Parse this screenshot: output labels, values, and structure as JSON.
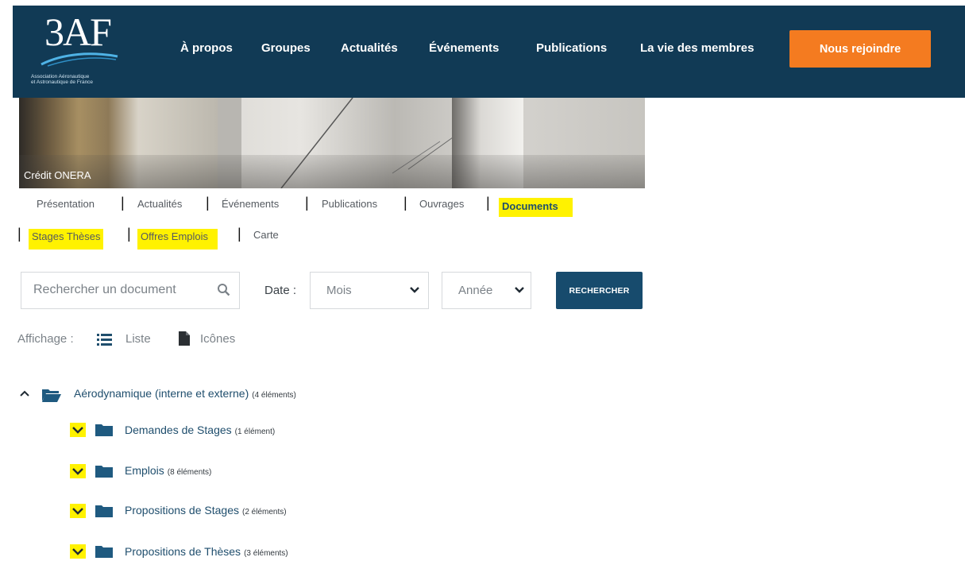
{
  "header": {
    "logo_text": "3AF",
    "logo_subtitle_line1": "Association Aéronautique",
    "logo_subtitle_line2": "et Astronautique de France",
    "nav": [
      "À propos",
      "Groupes",
      "Actualités",
      "Événements",
      "Publications",
      "La vie des membres"
    ],
    "join_label": "Nous rejoindre",
    "bg_color": "#113a55",
    "accent_color": "#f47b20"
  },
  "hero": {
    "credit": "Crédit ONERA"
  },
  "subnav": {
    "row1": [
      "Présentation",
      "Actualités",
      "Événements",
      "Publications",
      "Ouvrages",
      "Documents"
    ],
    "row2": [
      "Stages Thèses",
      "Offres Emplois",
      "Carte"
    ],
    "highlight_color": "#fff200"
  },
  "search": {
    "placeholder": "Rechercher un document",
    "date_label": "Date :",
    "month_value": "Mois",
    "year_value": "Année",
    "button_label": "RECHERCHER"
  },
  "display": {
    "label": "Affichage :",
    "list_label": "Liste",
    "icons_label": "Icônes"
  },
  "tree": {
    "root": {
      "label": "Aérodynamique (interne et externe)",
      "count": "(4 éléments)"
    },
    "children": [
      {
        "label": "Demandes de Stages",
        "count": "(1 élément)"
      },
      {
        "label": "Emplois",
        "count": "(8 éléments)"
      },
      {
        "label": "Propositions de Stages",
        "count": "(2 éléments)"
      },
      {
        "label": "Propositions de Thèses",
        "count": "(3 éléments)"
      }
    ]
  }
}
